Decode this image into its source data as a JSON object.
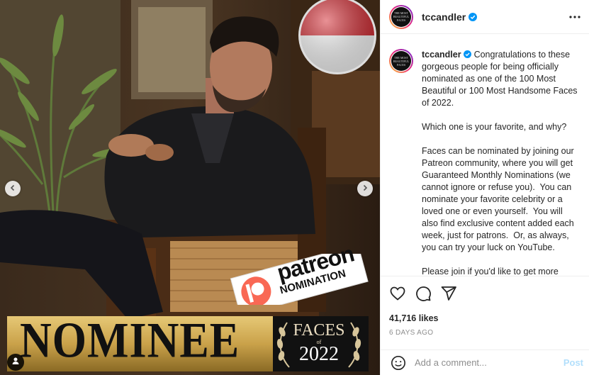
{
  "post": {
    "username": "tccandler",
    "avatar_text": "THE MOST BEAUTIFUL FACES",
    "caption": "Congratulations to these gorgeous people for being officially nominated as one of the 100 Most Beautiful or 100 Most Handsome Faces of 2022.\n\nWhich one is your favorite, and why?\n\nFaces can be nominated by joining our Patreon community, where you will get Guaranteed Monthly Nominations (we cannot ignore or refuse you).  You can nominate your favorite celebrity or a loved one or even yourself.  You will also find exclusive content added each week, just for patrons.  Or, as always, you can try your luck on YouTube.\n\nPlease join if you'd like to get more involved, or just support the channel: ",
    "likes": "41,716 likes",
    "timestamp": "6 DAYS AGO"
  },
  "image": {
    "badge_line1": "patreon",
    "badge_line2": "NOMINATION",
    "nominee": "NOMINEE",
    "faces_title": "FACES",
    "faces_of": "of",
    "faces_year": "2022"
  },
  "comment": {
    "placeholder": "Add a comment...",
    "post_label": "Post"
  },
  "icons": [
    "verified-icon",
    "more-icon",
    "heart-icon",
    "comment-icon",
    "share-icon",
    "emoji-icon",
    "chevron-left-icon",
    "chevron-right-icon",
    "tag-user-icon"
  ],
  "colors": {
    "verified": "#0095f6",
    "post_disabled": "#b2dffc",
    "patreon": "#f96854"
  }
}
